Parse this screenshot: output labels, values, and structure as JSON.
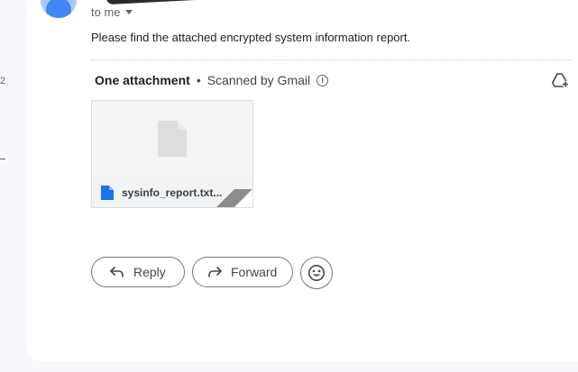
{
  "left_panel": {
    "count": "2"
  },
  "message": {
    "recipient_label": "to me",
    "body": "Please find the attached encrypted system information report."
  },
  "attachments": {
    "title": "One attachment",
    "separator": "•",
    "scan_status": "Scanned by Gmail",
    "info_icon": "i",
    "files": [
      {
        "name": "sysinfo_report.txt...",
        "icon": "doc-icon",
        "icon_color": "#1a73e8"
      }
    ]
  },
  "actions": {
    "reply_label": "Reply",
    "forward_label": "Forward"
  },
  "colors": {
    "accent": "#1a73e8",
    "background": "#f6f8fc",
    "surface": "#ffffff"
  }
}
